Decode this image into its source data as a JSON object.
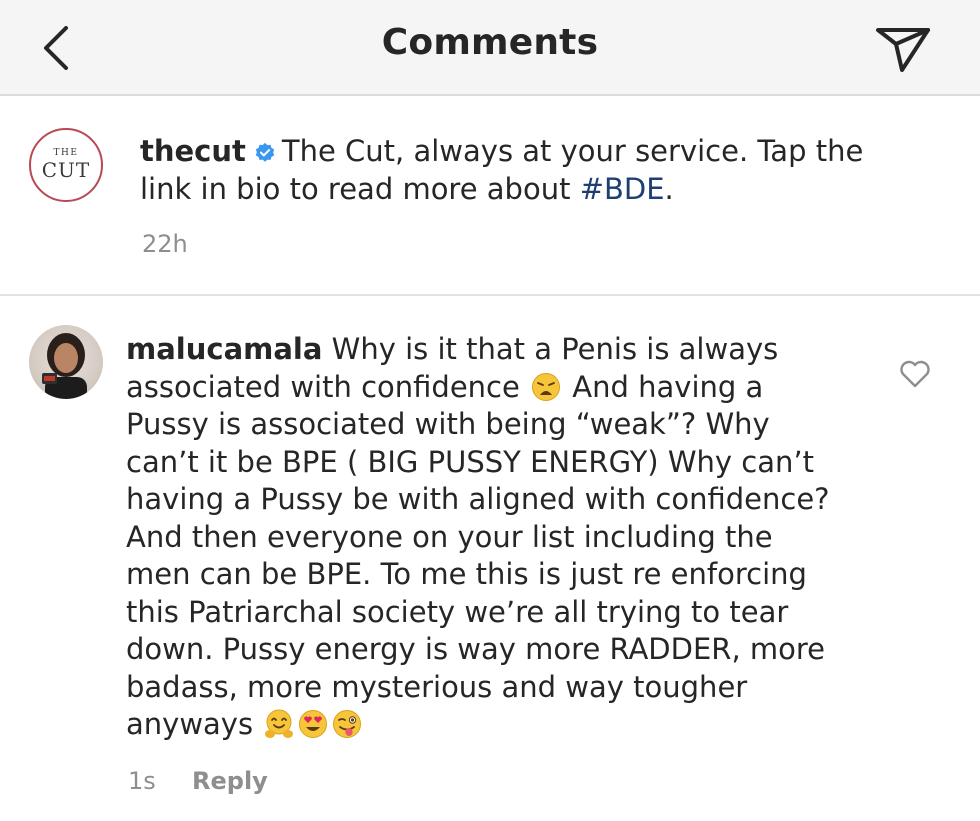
{
  "header": {
    "title": "Comments",
    "back_icon": "chevron-left-icon",
    "send_icon": "send-icon"
  },
  "caption": {
    "avatar_logo_small": "THE",
    "avatar_logo_large": "CUT",
    "username": "thecut",
    "verified_icon": "verified-badge-icon",
    "text_before": "The Cut, always at your service. Tap the link in bio to read more about ",
    "hashtag": "#BDE",
    "text_after": ".",
    "time": "22h"
  },
  "reply": {
    "username": "malucamala",
    "text_1": "Why is it that a Penis is always associated with confidence",
    "emoji_1": "weary-face-emoji",
    "text_2": "And having a Pussy is associated with being “weak”? Why can’t it be BPE ( BIG PUSSY ENERGY) Why can’t having a Pussy be with aligned with confidence?  And then everyone on your list including the men can be BPE. To me this is just re enforcing this Patriarchal society we’re all trying to tear down.  Pussy energy is way more RADDER, more badass, more mysterious and way tougher anyways",
    "emoji_end": [
      "hugging-face-emoji",
      "heart-eyes-emoji",
      "winking-tongue-emoji"
    ],
    "time": "1s",
    "reply_label": "Reply",
    "like_icon": "heart-outline-icon"
  },
  "colors": {
    "header_bg": "#f5f5f5",
    "text": "#262626",
    "meta": "#8e8e8e",
    "hashtag": "#1f3f73",
    "verified": "#3897f0",
    "cut_ring": "#b64a55"
  }
}
